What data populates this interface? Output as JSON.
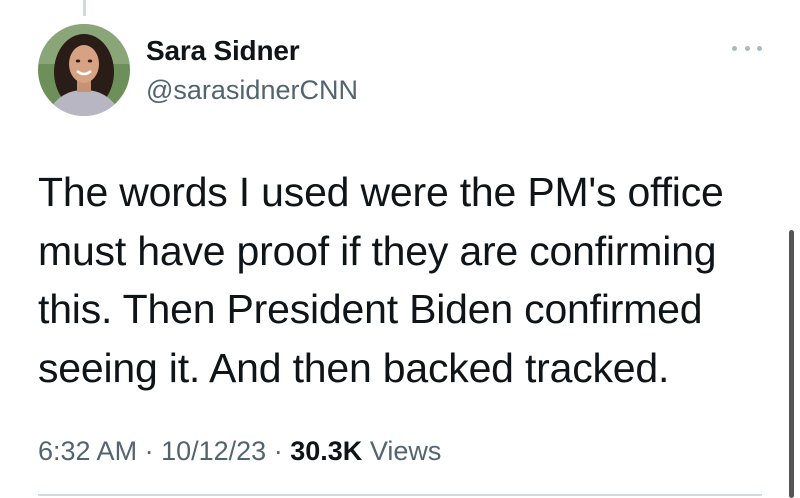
{
  "tweet": {
    "author": {
      "display_name": "Sara Sidner",
      "handle": "@sarasidnerCNN",
      "avatar_icon": "user-avatar"
    },
    "more_icon": "more-horizontal-icon",
    "text": "The words I used were the PM's office\nmust have proof if they are confirming\nthis.  Then President Biden confirmed\nseeing it. And then backed tracked.",
    "meta": {
      "time": "6:32 AM",
      "separator": "·",
      "date": "10/12/23",
      "views_count": "30.3K",
      "views_label": "Views"
    }
  },
  "colors": {
    "text_primary": "#0f1419",
    "text_secondary": "#536471",
    "divider": "#cfd9de"
  }
}
